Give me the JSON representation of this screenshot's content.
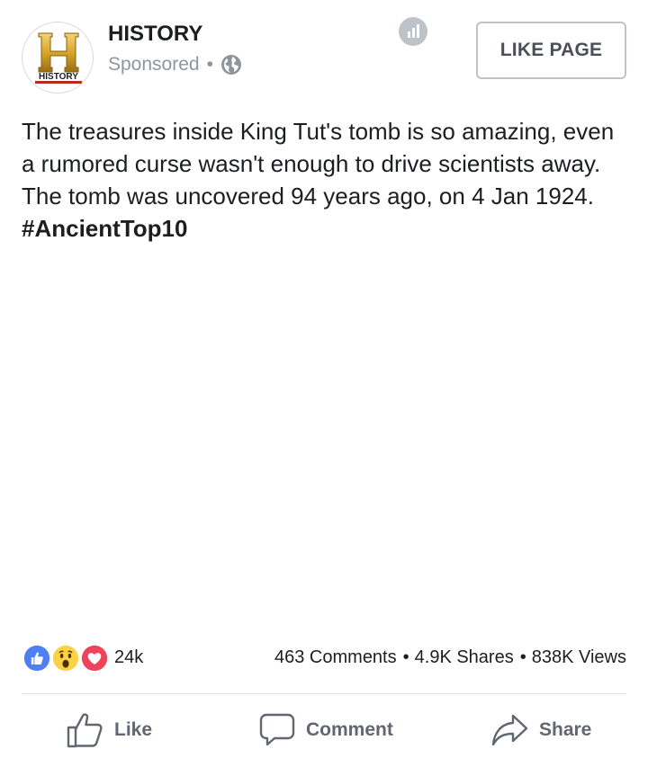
{
  "post": {
    "page_name": "HISTORY",
    "sponsored_label": "Sponsored",
    "dot": "•",
    "logo_text": "HISTORY",
    "logo_letter": "H",
    "like_page_label": "LIKE PAGE",
    "text_main": "The treasures inside King Tut's tomb is so amazing, even a rumored curse wasn't enough to drive scientists away. The tomb was uncovered 94 years ago, on 4 Jan 1924.  ",
    "hashtag": "#AncientTop10"
  },
  "stats": {
    "reaction_count": "24k",
    "comments": "463 Comments",
    "shares": "4.9K Shares",
    "views": "838K Views",
    "sep": "•",
    "reaction_icons": [
      "like-reaction-icon",
      "wow-reaction-icon",
      "love-reaction-icon"
    ]
  },
  "actions": {
    "like_label": "Like",
    "comment_label": "Comment",
    "share_label": "Share"
  },
  "colors": {
    "like_blue": "#4f7ff5",
    "love_red": "#f0425a",
    "wow_yellow": "#fcd144",
    "logo_gold": "#d7a62a",
    "logo_red": "#b72b1f"
  }
}
